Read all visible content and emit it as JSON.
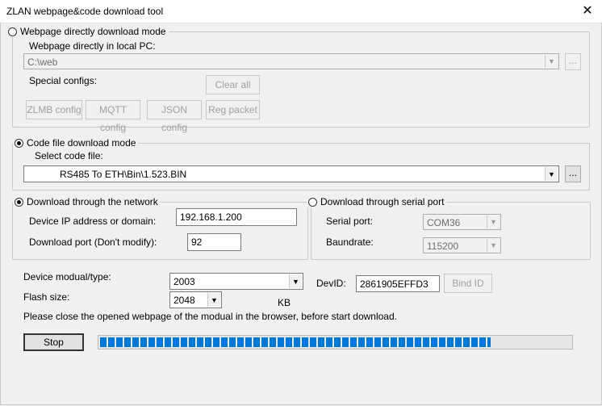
{
  "window": {
    "title": "ZLAN webpage&code download tool"
  },
  "webpage_mode": {
    "label": "Webpage directly download mode",
    "selected": false,
    "local_pc_label": "Webpage directly in local PC:",
    "path_value": "C:\\web",
    "browse_label": "...",
    "special_configs_label": "Special configs:",
    "clear_all_label": "Clear all",
    "buttons": {
      "zlmb": "ZLMB config",
      "mqtt": "MQTT config",
      "json": "JSON config",
      "reg": "Reg packet"
    }
  },
  "code_mode": {
    "label": "Code file download mode",
    "selected": true,
    "select_label": "Select code file:",
    "file_value": "RS485 To ETH\\Bin\\1.523.BIN",
    "browse_label": "..."
  },
  "network": {
    "label": "Download through the network",
    "selected": true,
    "ip_label": "Device IP address or domain:",
    "ip_value": "192.168.1.200",
    "port_label": "Download port (Don't modify):",
    "port_value": "92"
  },
  "serial": {
    "label": "Download through serial port",
    "selected": false,
    "port_label": "Serial port:",
    "port_value": "COM36",
    "baud_label": "Baundrate:",
    "baud_value": "115200"
  },
  "device": {
    "type_label": "Device modual/type:",
    "type_value": "2003",
    "flash_label": "Flash size:",
    "flash_value": "2048",
    "flash_unit": "KB",
    "devid_label": "DevID:",
    "devid_value": "2861905EFFD3",
    "bind_label": "Bind ID"
  },
  "notice": "Please close the opened webpage of the modual in the browser, before start download.",
  "stop_label": "Stop",
  "progress": {
    "percent": 83
  },
  "colors": {
    "progress": "#0078d7",
    "background": "#f0f0f0"
  }
}
